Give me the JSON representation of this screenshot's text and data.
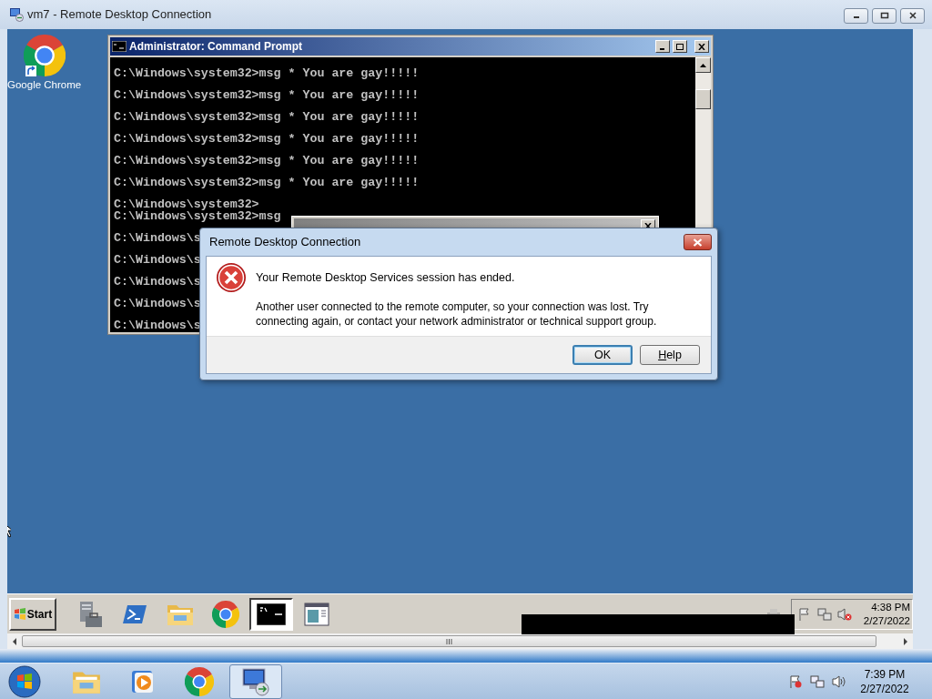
{
  "window": {
    "title": "vm7 - Remote Desktop Connection"
  },
  "desktop_icons": [
    {
      "label": "Google Chrome"
    }
  ],
  "console": {
    "title": "Administrator: Command Prompt",
    "lines": [
      {
        "text": "C:\\Windows\\system32>msg * You are gay!!!!!",
        "kind": "after_blank"
      },
      {
        "text": "C:\\Windows\\system32>msg * You are gay!!!!!",
        "kind": "after_blank"
      },
      {
        "text": "C:\\Windows\\system32>msg * You are gay!!!!!",
        "kind": "after_blank"
      },
      {
        "text": "C:\\Windows\\system32>msg * You are gay!!!!!",
        "kind": "after_blank"
      },
      {
        "text": "C:\\Windows\\system32>msg * You are gay!!!!!",
        "kind": "after_blank"
      },
      {
        "text": "C:\\Windows\\system32>msg * You are gay!!!!!",
        "kind": "after_blank"
      },
      {
        "text": "C:\\Windows\\system32>",
        "kind": "after_blank"
      },
      {
        "text": "C:\\Windows\\system32>msg",
        "kind": "continued"
      },
      {
        "text": "C:\\Windows\\s",
        "kind": "after_blank"
      },
      {
        "text": "C:\\Windows\\s",
        "kind": "after_blank"
      },
      {
        "text": "C:\\Windows\\s",
        "kind": "after_blank"
      },
      {
        "text": "C:\\Windows\\s",
        "kind": "after_blank"
      },
      {
        "text": "C:\\Windows\\s",
        "kind": "after_blank"
      }
    ]
  },
  "dialog": {
    "title": "Remote Desktop Connection",
    "heading": "Your Remote Desktop Services session has ended.",
    "message": "Another user connected to the remote computer, so your connection was lost. Try connecting again, or contact your network administrator or technical support group.",
    "buttons": [
      {
        "label": "OK",
        "default": true,
        "mnemonic": false
      },
      {
        "label": "Help",
        "default": false,
        "mnemonic": true
      }
    ]
  },
  "remote_taskbar": {
    "start": "Start",
    "items": [
      {
        "kind": "server",
        "active": false
      },
      {
        "kind": "powershell",
        "active": false
      },
      {
        "kind": "folder",
        "active": false
      },
      {
        "kind": "chrome",
        "active": false
      },
      {
        "kind": "console",
        "active": true
      },
      {
        "kind": "window",
        "active": false
      }
    ],
    "clock": {
      "time": "4:38 PM",
      "date": "2/27/2022"
    }
  },
  "host_taskbar": {
    "items": [
      {
        "kind": "folder",
        "active": false
      },
      {
        "kind": "media",
        "active": false
      },
      {
        "kind": "chrome",
        "active": false
      },
      {
        "kind": "remote",
        "active": true
      }
    ],
    "clock": {
      "time": "7:39 PM",
      "date": "2/27/2022"
    }
  }
}
